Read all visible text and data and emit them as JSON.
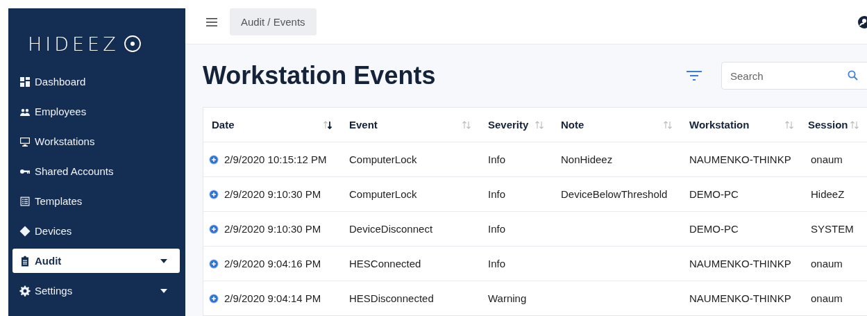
{
  "logo": {
    "text": "HIDEEZ"
  },
  "sidebar": {
    "items": [
      {
        "label": "Dashboard",
        "selected": false,
        "expandable": false
      },
      {
        "label": "Employees",
        "selected": false,
        "expandable": false
      },
      {
        "label": "Workstations",
        "selected": false,
        "expandable": false
      },
      {
        "label": "Shared Accounts",
        "selected": false,
        "expandable": false
      },
      {
        "label": "Templates",
        "selected": false,
        "expandable": false
      },
      {
        "label": "Devices",
        "selected": false,
        "expandable": false
      },
      {
        "label": "Audit",
        "selected": true,
        "expandable": true
      },
      {
        "label": "Settings",
        "selected": false,
        "expandable": true
      }
    ]
  },
  "breadcrumb": "Audit / Events",
  "page": {
    "title": "Workstation Events"
  },
  "search": {
    "placeholder": "Search"
  },
  "table": {
    "columns": [
      {
        "label": "Date",
        "sorted": true
      },
      {
        "label": "Event",
        "sorted": false
      },
      {
        "label": "Severity",
        "sorted": false
      },
      {
        "label": "Note",
        "sorted": false
      },
      {
        "label": "Workstation",
        "sorted": false
      },
      {
        "label": "Session",
        "sorted": false
      }
    ],
    "rows": [
      [
        "2/9/2020 10:15:12 PM",
        "ComputerLock",
        "Info",
        "NonHideez",
        "NAUMENKO-THINKP",
        "onaum"
      ],
      [
        "2/9/2020 9:10:30 PM",
        "ComputerLock",
        "Info",
        "DeviceBelowThreshold",
        "DEMO-PC",
        "HideeZ"
      ],
      [
        "2/9/2020 9:10:30 PM",
        "DeviceDisconnect",
        "Info",
        "",
        "DEMO-PC",
        "SYSTEM"
      ],
      [
        "2/9/2020 9:04:16 PM",
        "HESConnected",
        "Info",
        "",
        "NAUMENKO-THINKP",
        "onaum"
      ],
      [
        "2/9/2020 9:04:14 PM",
        "HESDisconnected",
        "Warning",
        "",
        "NAUMENKO-THINKP",
        "onaum"
      ]
    ]
  }
}
